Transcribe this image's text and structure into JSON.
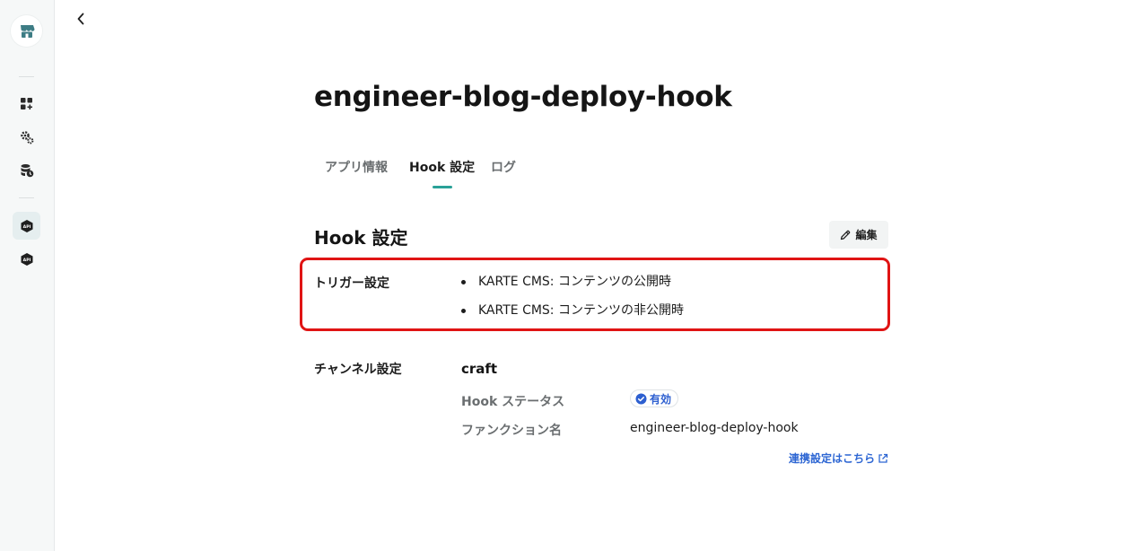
{
  "page": {
    "title": "engineer-blog-deploy-hook"
  },
  "sidebar": {
    "logo_icon": "store-icon",
    "items": [
      {
        "icon": "dashboard-add-icon",
        "active": false
      },
      {
        "icon": "settings-gears-icon",
        "active": false
      },
      {
        "icon": "database-clock-icon",
        "active": false
      },
      {
        "icon": "api-hexagon-icon",
        "label": "API",
        "active": true
      },
      {
        "icon": "api-hexagon-icon",
        "label": "API",
        "active": false
      }
    ]
  },
  "tabs": [
    {
      "label": "アプリ情報",
      "active": false
    },
    {
      "label": "Hook 設定",
      "active": true
    },
    {
      "label": "ログ",
      "active": false
    }
  ],
  "section": {
    "title": "Hook 設定",
    "edit_label": "編集"
  },
  "trigger": {
    "label": "トリガー設定",
    "items": [
      "KARTE CMS: コンテンツの公開時",
      "KARTE CMS: コンテンツの非公開時"
    ]
  },
  "channel": {
    "label": "チャンネル設定",
    "name": "craft",
    "status_key": "Hook ステータス",
    "status_value": "有効",
    "function_key": "ファンクション名",
    "function_value": "engineer-blog-deploy-hook",
    "link_label": "連携設定はこちら"
  },
  "colors": {
    "accent": "#2aa198",
    "highlight": "#e01414",
    "link": "#2d66d3"
  }
}
